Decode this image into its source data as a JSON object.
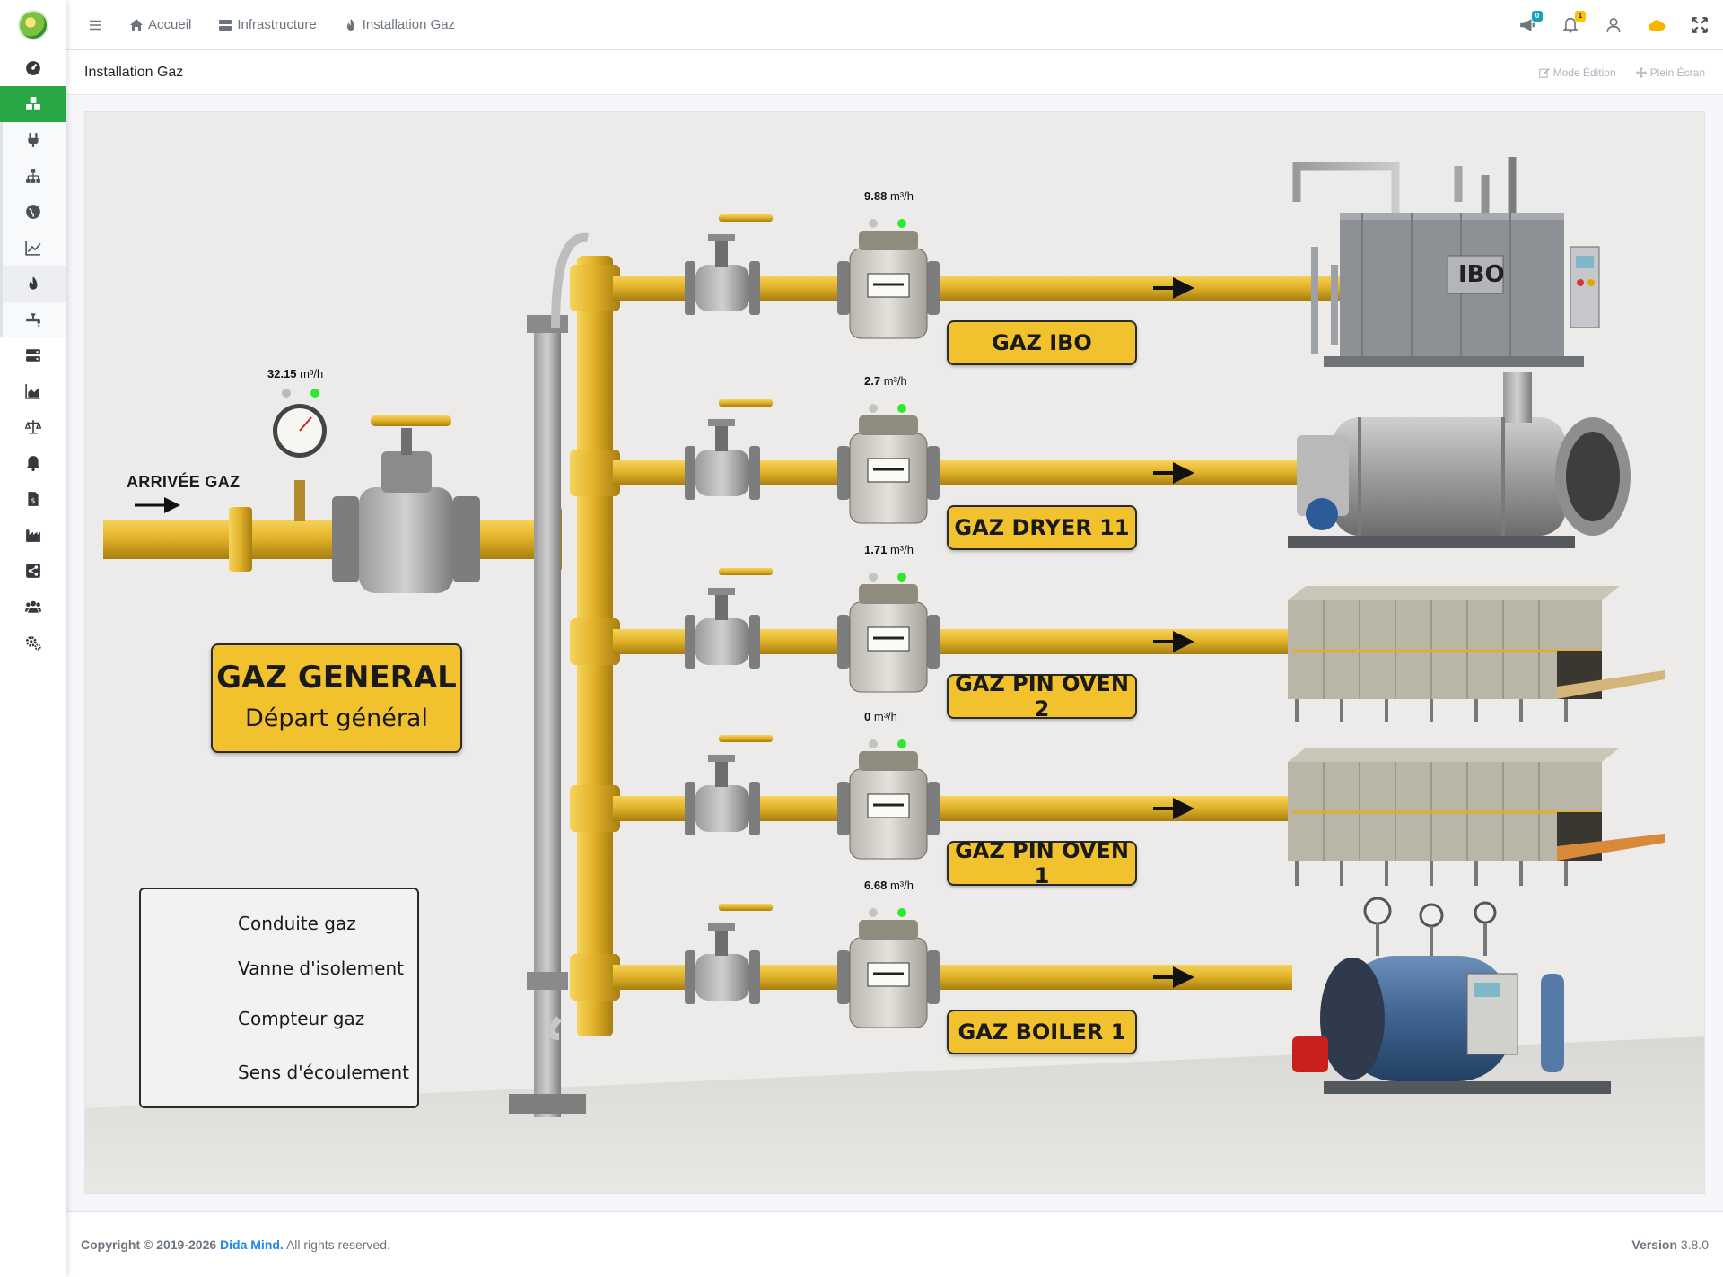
{
  "nav": {
    "breadcrumbs": [
      {
        "label": "Accueil",
        "icon": "home-icon"
      },
      {
        "label": "Infrastructure",
        "icon": "server-icon"
      },
      {
        "label": "Installation Gaz",
        "icon": "flame-icon"
      }
    ],
    "badges": {
      "messages": "0",
      "notifications": "1"
    }
  },
  "page": {
    "title": "Installation Gaz",
    "actions": {
      "edit": "Mode Édition",
      "fullscreen": "Plein Écran"
    }
  },
  "synoptic": {
    "inlet_label": "ARRIVÉE GAZ",
    "general": {
      "title": "GAZ GENERAL",
      "subtitle": "Départ général",
      "flow": "32.15",
      "unit": "m³/h"
    },
    "branches": [
      {
        "name": "GAZ IBO",
        "flow": "9.88",
        "unit": "m³/h"
      },
      {
        "name": "GAZ DRYER 11",
        "flow": "2.7",
        "unit": "m³/h"
      },
      {
        "name": "GAZ PIN OVEN 2",
        "flow": "1.71",
        "unit": "m³/h"
      },
      {
        "name": "GAZ PIN OVEN 1",
        "flow": "0",
        "unit": "m³/h"
      },
      {
        "name": "GAZ BOILER 1",
        "flow": "6.68",
        "unit": "m³/h"
      }
    ],
    "equipment_plate": "IBO",
    "legend": {
      "pipe": "Conduite gaz",
      "valve": "Vanne d'isolement",
      "meter": "Compteur gaz",
      "flow": "Sens d'écoulement"
    },
    "colors": {
      "pipe": "#e3b42b",
      "sign": "#f2c12e",
      "status_ok": "#2ee82e"
    }
  },
  "footer": {
    "copyright": "Copyright © 2019-2026",
    "brand": "Dida Mind.",
    "rights": "All rights reserved.",
    "version_label": "Version",
    "version": "3.8.0"
  },
  "colors": {
    "accent": "#28a745",
    "link": "#1e88e5"
  }
}
